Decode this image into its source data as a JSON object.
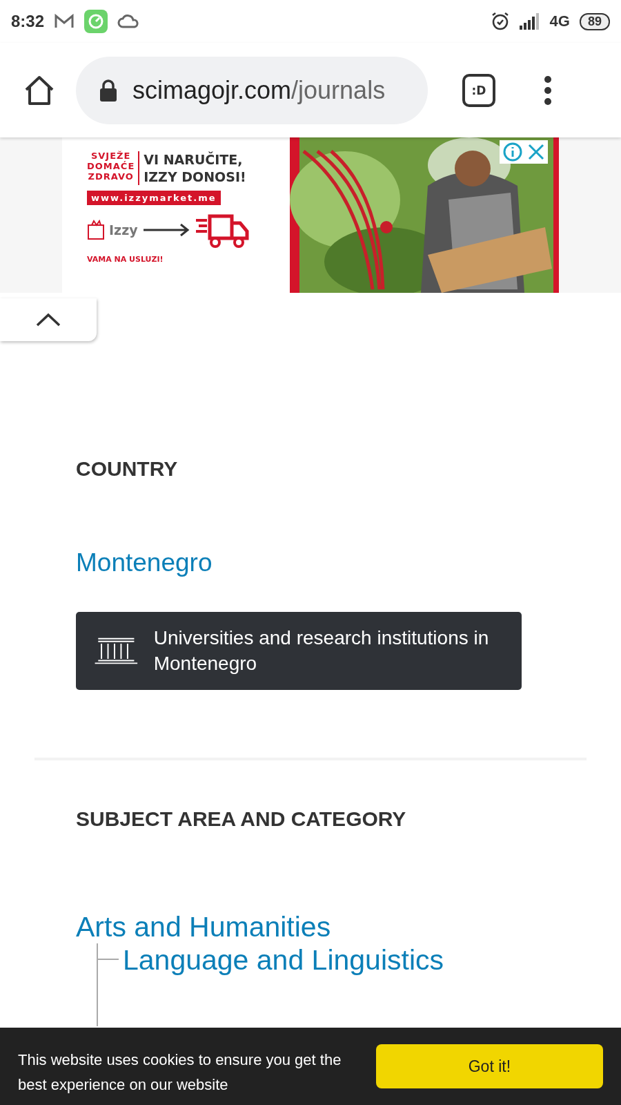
{
  "status_bar": {
    "time": "8:32",
    "network": "4G",
    "battery": "89"
  },
  "browser": {
    "url_host": "scimagojr.com",
    "url_path": "/journals",
    "tabs_badge": ":D"
  },
  "ad": {
    "tagline_left": [
      "SVJEŽE",
      "DOMAĆE",
      "ZDRAVO"
    ],
    "tagline_right": [
      "VI NARUČITE,",
      "IZZY DONOSI!"
    ],
    "website": "www.izzymarket.me",
    "brand": "Izzy",
    "slogan": "VAMA NA USLUZI!",
    "image": {
      "kind": "picture"
    }
  },
  "country": {
    "heading": "COUNTRY",
    "name": "Montenegro",
    "button": "Universities and research institutions in Montenegro"
  },
  "subjects": {
    "heading": "SUBJECT AREA AND CATEGORY",
    "areas": [
      {
        "label": "Arts and Humanities",
        "children": [
          {
            "label": "Language and Linguistics"
          }
        ]
      }
    ]
  },
  "cookie_bar": {
    "message": "This website uses cookies to ensure you get the best experience on our website",
    "button": "Got it!"
  }
}
